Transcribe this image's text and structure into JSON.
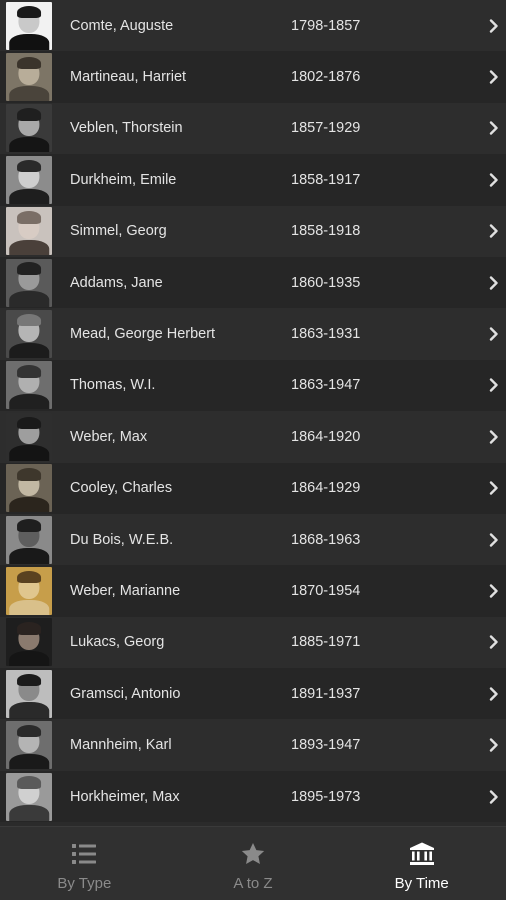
{
  "people": [
    {
      "name": "Comte, Auguste",
      "years": "1798-1857",
      "portrait": {
        "bg": "#f2f2f2",
        "skin": "#c9c9c9",
        "hair": "#1a1a1a",
        "cloth": "#111111"
      }
    },
    {
      "name": "Martineau, Harriet",
      "years": "1802-1876",
      "portrait": {
        "bg": "#7d7566",
        "skin": "#b8ad99",
        "hair": "#3b342b",
        "cloth": "#4a443b"
      }
    },
    {
      "name": "Veblen, Thorstein",
      "years": "1857-1929",
      "portrait": {
        "bg": "#3a3a3a",
        "skin": "#a9a9a9",
        "hair": "#1f1f1f",
        "cloth": "#151515"
      }
    },
    {
      "name": "Durkheim, Emile",
      "years": "1858-1917",
      "portrait": {
        "bg": "#8c8c8c",
        "skin": "#cfcfcf",
        "hair": "#2a2a2a",
        "cloth": "#1e1e1e"
      }
    },
    {
      "name": "Simmel, Georg",
      "years": "1858-1918",
      "portrait": {
        "bg": "#c9c2bd",
        "skin": "#d8ccc4",
        "hair": "#7a6e66",
        "cloth": "#4a403a"
      }
    },
    {
      "name": "Addams, Jane",
      "years": "1860-1935",
      "portrait": {
        "bg": "#5a5a5a",
        "skin": "#9a9a9a",
        "hair": "#222222",
        "cloth": "#2a2a2a"
      }
    },
    {
      "name": "Mead, George Herbert",
      "years": "1863-1931",
      "portrait": {
        "bg": "#4a4a4a",
        "skin": "#b5b5b5",
        "hair": "#777777",
        "cloth": "#1c1c1c"
      }
    },
    {
      "name": "Thomas, W.I.",
      "years": "1863-1947",
      "portrait": {
        "bg": "#6e6e6e",
        "skin": "#b0b0b0",
        "hair": "#333333",
        "cloth": "#202020"
      }
    },
    {
      "name": "Weber, Max",
      "years": "1864-1920",
      "portrait": {
        "bg": "#2e2e2e",
        "skin": "#9e9e9e",
        "hair": "#1a1a1a",
        "cloth": "#141414"
      }
    },
    {
      "name": "Cooley, Charles",
      "years": "1864-1929",
      "portrait": {
        "bg": "#6b6355",
        "skin": "#c2b8a3",
        "hair": "#3e372c",
        "cloth": "#2b251d"
      }
    },
    {
      "name": "Du Bois, W.E.B.",
      "years": "1868-1963",
      "portrait": {
        "bg": "#8a8a8a",
        "skin": "#5e5e5e",
        "hair": "#1f1f1f",
        "cloth": "#191919"
      }
    },
    {
      "name": "Weber, Marianne",
      "years": "1870-1954",
      "portrait": {
        "bg": "#c79e4a",
        "skin": "#e0c68e",
        "hair": "#5a4220",
        "cloth": "#d9c08a"
      }
    },
    {
      "name": "Lukacs, Georg",
      "years": "1885-1971",
      "portrait": {
        "bg": "#1e1e1e",
        "skin": "#8a7a6e",
        "hair": "#2a2320",
        "cloth": "#151515"
      }
    },
    {
      "name": "Gramsci, Antonio",
      "years": "1891-1937",
      "portrait": {
        "bg": "#bdbdbd",
        "skin": "#8a8a8a",
        "hair": "#1b1b1b",
        "cloth": "#2a2a2a"
      }
    },
    {
      "name": "Mannheim, Karl",
      "years": "1893-1947",
      "portrait": {
        "bg": "#6e6e6e",
        "skin": "#b4b4b4",
        "hair": "#2a2a2a",
        "cloth": "#1a1a1a"
      }
    },
    {
      "name": "Horkheimer, Max",
      "years": "1895-1973",
      "portrait": {
        "bg": "#9a9a9a",
        "skin": "#d0d0d0",
        "hair": "#5a5a5a",
        "cloth": "#3a3a3a"
      }
    }
  ],
  "tabs": [
    {
      "label": "By Type",
      "icon": "list-icon",
      "active": false
    },
    {
      "label": "A to Z",
      "icon": "star-icon",
      "active": false
    },
    {
      "label": "By Time",
      "icon": "museum-icon",
      "active": true
    }
  ],
  "colors": {
    "active": "#ffffff",
    "inactive": "#8a8a8a",
    "chevron": "#e0e0e0"
  }
}
